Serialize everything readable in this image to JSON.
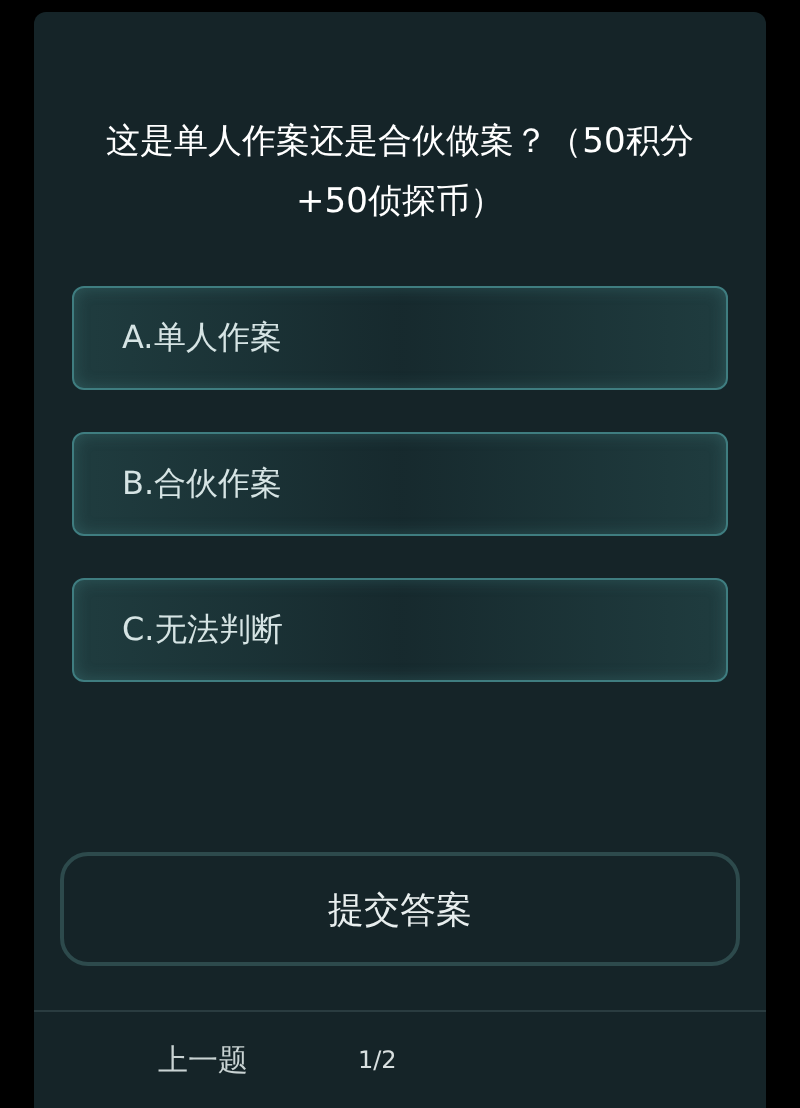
{
  "question": "这是单人作案还是合伙做案？（50积分+50侦探币）",
  "options": [
    {
      "label": "A.单人作案",
      "selected": false
    },
    {
      "label": "B.合伙作案",
      "selected": false
    },
    {
      "label": "C.无法判断",
      "selected": false
    }
  ],
  "submit_button": "提交答案",
  "footer": {
    "prev_button": "上一题",
    "page_indicator": "1/2"
  }
}
